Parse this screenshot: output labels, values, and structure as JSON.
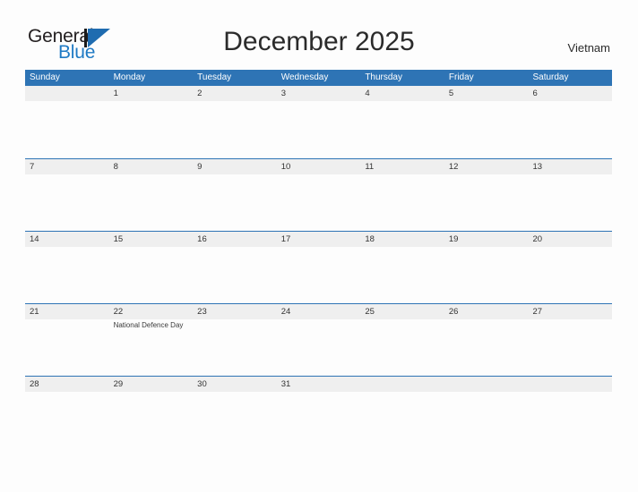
{
  "brand": {
    "name_part1": "General",
    "name_part2": "Blue",
    "color_dark": "#231f20",
    "color_blue": "#1f7ac4"
  },
  "header": {
    "title": "December 2025",
    "country": "Vietnam"
  },
  "theme": {
    "header_blue": "#2e74b5",
    "band_gray": "#efefef",
    "page_bg": "#fdfdfd",
    "text": "#333333"
  },
  "calendar": {
    "weekdays": [
      "Sunday",
      "Monday",
      "Tuesday",
      "Wednesday",
      "Thursday",
      "Friday",
      "Saturday"
    ],
    "weeks": [
      [
        {
          "day": ""
        },
        {
          "day": "1"
        },
        {
          "day": "2"
        },
        {
          "day": "3"
        },
        {
          "day": "4"
        },
        {
          "day": "5"
        },
        {
          "day": "6"
        }
      ],
      [
        {
          "day": "7"
        },
        {
          "day": "8"
        },
        {
          "day": "9"
        },
        {
          "day": "10"
        },
        {
          "day": "11"
        },
        {
          "day": "12"
        },
        {
          "day": "13"
        }
      ],
      [
        {
          "day": "14"
        },
        {
          "day": "15"
        },
        {
          "day": "16"
        },
        {
          "day": "17"
        },
        {
          "day": "18"
        },
        {
          "day": "19"
        },
        {
          "day": "20"
        }
      ],
      [
        {
          "day": "21"
        },
        {
          "day": "22",
          "event": "National Defence Day"
        },
        {
          "day": "23"
        },
        {
          "day": "24"
        },
        {
          "day": "25"
        },
        {
          "day": "26"
        },
        {
          "day": "27"
        }
      ],
      [
        {
          "day": "28"
        },
        {
          "day": "29"
        },
        {
          "day": "30"
        },
        {
          "day": "31"
        },
        {
          "day": ""
        },
        {
          "day": ""
        },
        {
          "day": ""
        }
      ]
    ]
  }
}
